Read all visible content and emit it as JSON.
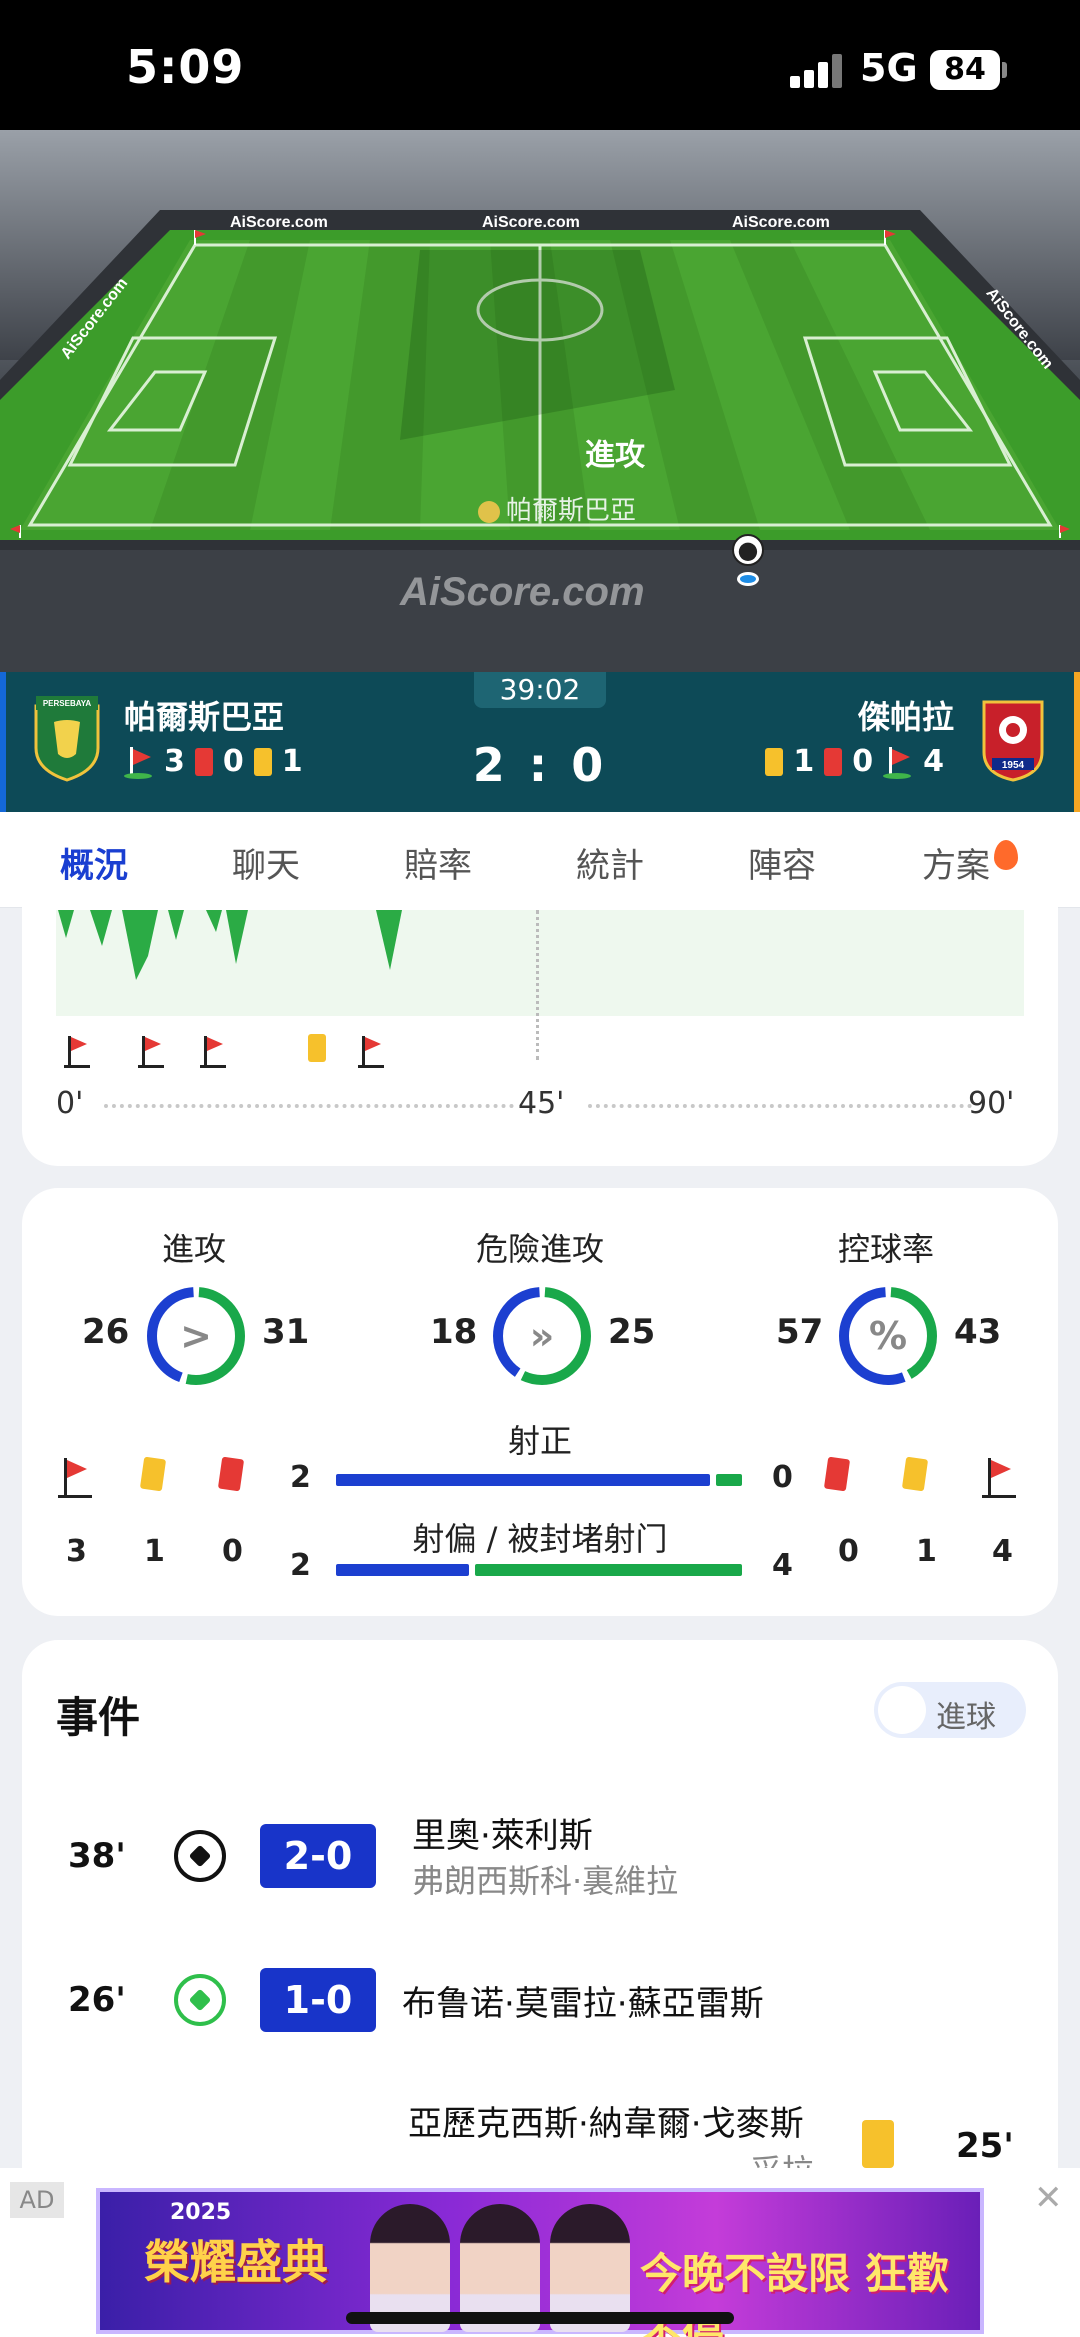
{
  "status_bar": {
    "time": "5:09",
    "network": "5G",
    "battery": "84"
  },
  "pitch": {
    "brand_text": "AiScore.com",
    "watermark": "AiScore.com",
    "state_label": "進攻",
    "attacking_team": "帕爾斯巴亞"
  },
  "match": {
    "clock": "39:02",
    "score": "2 : 0",
    "home": {
      "name": "帕爾斯巴亞",
      "crest_text": "PERSEBAYA",
      "corners": "3",
      "red_cards": "0",
      "yellow_cards": "1"
    },
    "away": {
      "name": "傑帕拉",
      "crest_text": "1954",
      "yellow_cards": "1",
      "red_cards": "0",
      "corners": "4"
    }
  },
  "tabs": [
    "概況",
    "聊天",
    "賠率",
    "統計",
    "陣容",
    "方案"
  ],
  "active_tab": "概況",
  "timeline": {
    "axis": [
      "0'",
      "45'",
      "90'"
    ],
    "event_minutes": [
      4,
      12,
      19,
      33,
      40
    ]
  },
  "stats": {
    "attacks": {
      "label": "進攻",
      "home": "26",
      "away": "31",
      "home_value": 26,
      "away_value": 31
    },
    "dangerous_attacks": {
      "label": "危險進攻",
      "home": "18",
      "away": "25",
      "home_value": 18,
      "away_value": 25
    },
    "possession": {
      "label": "控球率",
      "home": "57",
      "away": "43",
      "home_value": 57,
      "away_value": 43,
      "glyph": "%"
    },
    "on_target": {
      "label": "射正",
      "home": "2",
      "away": "0",
      "home_value": 2,
      "away_value": 0
    },
    "off_target": {
      "label": "射偏 / 被封堵射门",
      "home": "2",
      "away": "4",
      "home_value": 2,
      "away_value": 4
    },
    "home_totals": {
      "corners": "3",
      "yellow": "1",
      "red": "0"
    },
    "away_totals": {
      "red": "0",
      "yellow": "1",
      "corners": "4"
    }
  },
  "events": {
    "title": "事件",
    "toggle_label": "進球",
    "items": [
      {
        "minute": "38'",
        "score": "2-0",
        "player": "里奧·萊利斯",
        "assist": "弗朗西斯科·裏維拉"
      },
      {
        "minute": "26'",
        "score": "1-0",
        "player": "布鲁诺·莫雷拉·蘇亞雷斯"
      },
      {
        "minute": "25'",
        "player": "亞歷克西斯·納韋爾·戈麥斯",
        "assist": "采拉"
      }
    ]
  },
  "ad": {
    "tag": "AD",
    "close": "✕",
    "year": "2025",
    "headline_left": "榮耀盛典",
    "headline_right": "今晚不設限 狂歡不停"
  },
  "colors": {
    "home": "#1c3fd0",
    "away": "#19a84a",
    "accent": "#1a3fd1",
    "scoreboard": "#0d4a57"
  }
}
